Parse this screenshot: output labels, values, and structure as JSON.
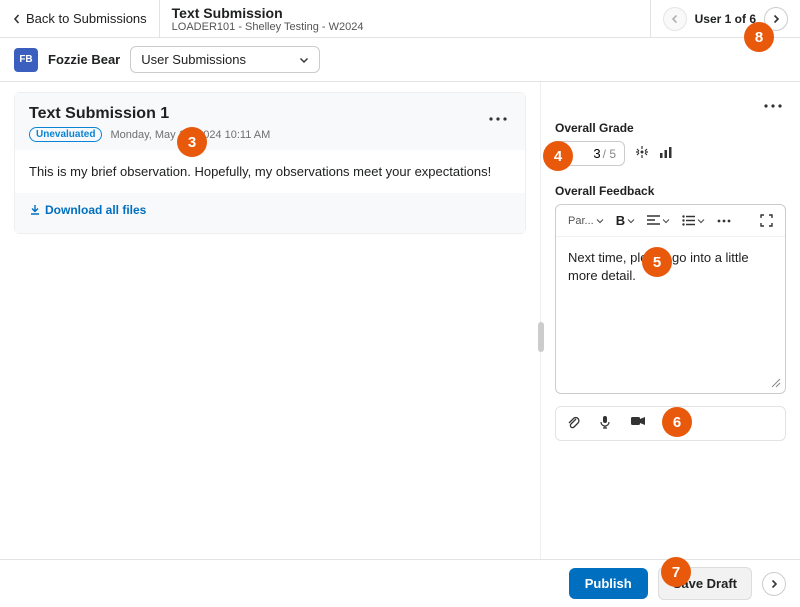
{
  "header": {
    "back_label": "Back to Submissions",
    "title": "Text Submission",
    "subtitle": "LOADER101 - Shelley Testing - W2024",
    "user_position": "User 1 of 6"
  },
  "toolbar": {
    "user_initials": "FB",
    "user_name": "Fozzie Bear",
    "dropdown_label": "User Submissions"
  },
  "submission": {
    "title": "Text Submission 1",
    "status": "Unevaluated",
    "timestamp": "Monday, May 13, 2024 10:11 AM",
    "body": "This is my brief observation. Hopefully, my observations meet your expectations!",
    "download_label": "Download all files"
  },
  "grading": {
    "overall_grade_label": "Overall Grade",
    "grade_value": "3",
    "grade_denom": "/ 5",
    "overall_feedback_label": "Overall Feedback",
    "editor": {
      "paragraph_label": "Par...",
      "feedback_text": "Next time, please go into a little more detail."
    }
  },
  "footer": {
    "publish_label": "Publish",
    "save_draft_label": "Save Draft"
  },
  "markers": {
    "m3": "3",
    "m4": "4",
    "m5": "5",
    "m6": "6",
    "m7": "7",
    "m8": "8"
  }
}
